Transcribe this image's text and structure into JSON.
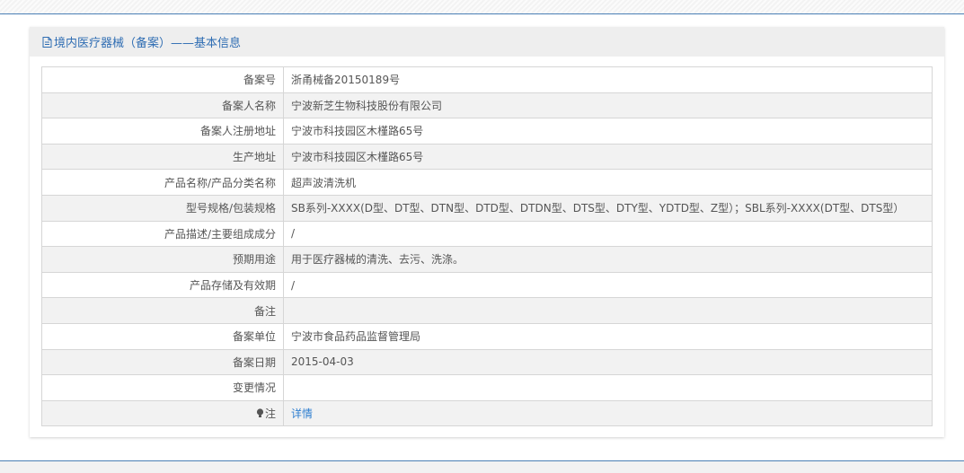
{
  "header": {
    "title": "境内医疗器械（备案）——基本信息"
  },
  "rows": [
    {
      "label": "备案号",
      "value": "浙甬械备20150189号"
    },
    {
      "label": "备案人名称",
      "value": "宁波新芝生物科技股份有限公司"
    },
    {
      "label": "备案人注册地址",
      "value": "宁波市科技园区木槿路65号"
    },
    {
      "label": "生产地址",
      "value": "宁波市科技园区木槿路65号"
    },
    {
      "label": "产品名称/产品分类名称",
      "value": "超声波清洗机"
    },
    {
      "label": "型号规格/包装规格",
      "value": "SB系列-XXXX(D型、DT型、DTN型、DTD型、DTDN型、DTS型、DTY型、YDTD型、Z型）；SBL系列-XXXX(DT型、DTS型）"
    },
    {
      "label": "产品描述/主要组成成分",
      "value": "/"
    },
    {
      "label": "预期用途",
      "value": "用于医疗器械的清洗、去污、洗涤。"
    },
    {
      "label": "产品存储及有效期",
      "value": "/"
    },
    {
      "label": "备注",
      "value": ""
    },
    {
      "label": "备案单位",
      "value": "宁波市食品药品监督管理局"
    },
    {
      "label": "备案日期",
      "value": "2015-04-03"
    },
    {
      "label": "变更情况",
      "value": ""
    },
    {
      "label": "注",
      "value": "详情",
      "icon": "lightbulb-icon"
    }
  ],
  "colors": {
    "accent_blue": "#2f6db3",
    "link_blue": "#2f7fd0",
    "header_bg": "#eeeeee",
    "row_alt_bg": "#f2f2f2"
  }
}
